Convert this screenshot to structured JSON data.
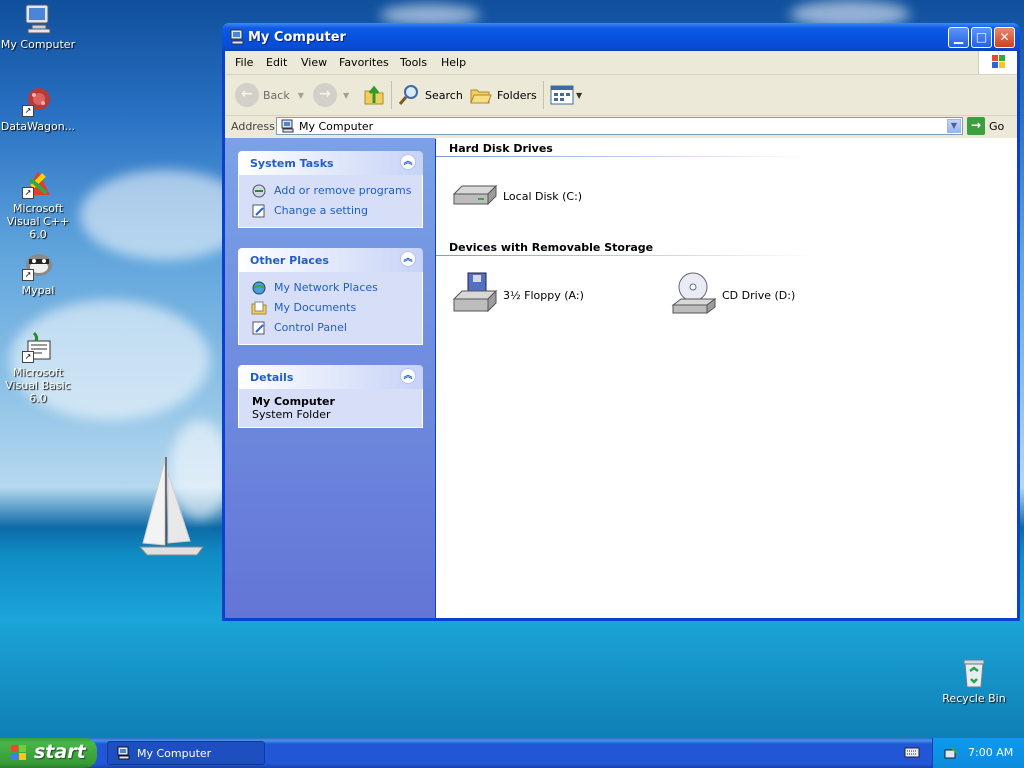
{
  "desktop": {
    "icons": [
      {
        "label": "My Computer",
        "icon": "my-computer-icon"
      },
      {
        "label": "DataWagon...",
        "icon": "datawagon-icon"
      },
      {
        "label": "Microsoft Visual C++ 6.0",
        "icon": "visual-cpp-icon"
      },
      {
        "label": "Mypal",
        "icon": "mypal-icon"
      },
      {
        "label": "Microsoft Visual Basic 6.0",
        "icon": "visual-basic-icon"
      },
      {
        "label": "Recycle Bin",
        "icon": "recycle-bin-icon"
      }
    ]
  },
  "window": {
    "title": "My Computer",
    "menu": [
      "File",
      "Edit",
      "View",
      "Favorites",
      "Tools",
      "Help"
    ],
    "toolbar": {
      "back_label": "Back",
      "search_label": "Search",
      "folders_label": "Folders"
    },
    "address": {
      "label": "Address",
      "value": "My Computer",
      "go_label": "Go"
    },
    "left_pane": {
      "system_tasks": {
        "title": "System Tasks",
        "items": [
          "Add or remove programs",
          "Change a setting"
        ]
      },
      "other_places": {
        "title": "Other Places",
        "items": [
          "My Network Places",
          "My Documents",
          "Control Panel"
        ]
      },
      "details": {
        "title": "Details",
        "name": "My Computer",
        "type": "System Folder"
      }
    },
    "groups": [
      {
        "title": "Hard Disk Drives",
        "items": [
          "Local Disk (C:)"
        ]
      },
      {
        "title": "Devices with Removable Storage",
        "items": [
          "3½ Floppy (A:)",
          "CD Drive (D:)"
        ]
      }
    ]
  },
  "taskbar": {
    "start_label": "start",
    "task_label": "My Computer",
    "clock": "7:00 AM"
  },
  "colors": {
    "xp_blue": "#0a3fd0",
    "task_link": "#215dc6",
    "start_green": "#3c9b3c"
  }
}
